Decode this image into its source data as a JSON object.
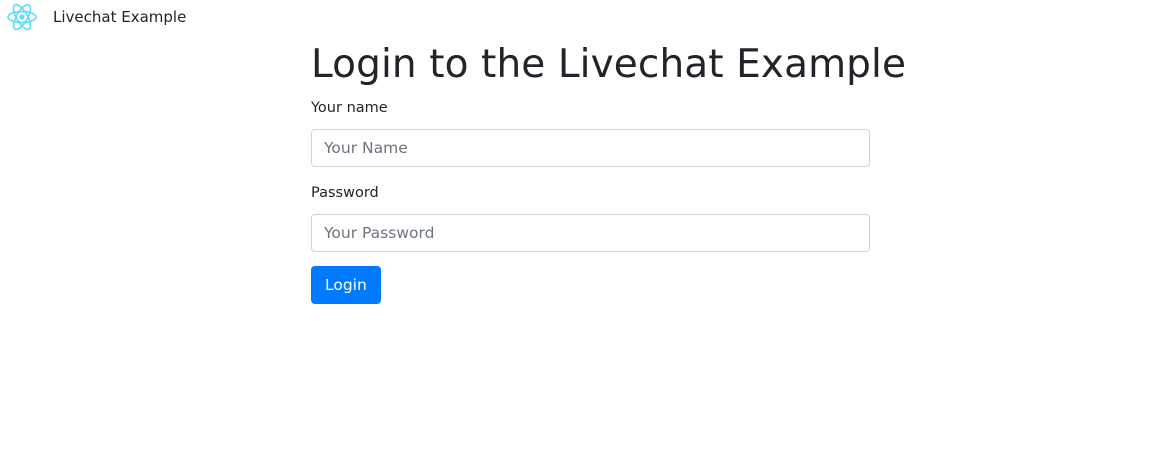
{
  "navbar": {
    "brand_label": "Livechat Example",
    "logo_icon": "react-atom-icon",
    "logo_color": "#61dafb"
  },
  "main": {
    "title": "Login to the Livechat Example",
    "name_field": {
      "label": "Your name",
      "placeholder": "Your Name",
      "value": ""
    },
    "password_field": {
      "label": "Password",
      "placeholder": "Your Password",
      "value": ""
    },
    "login_button_label": "Login"
  },
  "colors": {
    "primary": "#007bff",
    "text": "#212529",
    "input_border": "#ced4da",
    "placeholder": "#6c757d"
  }
}
